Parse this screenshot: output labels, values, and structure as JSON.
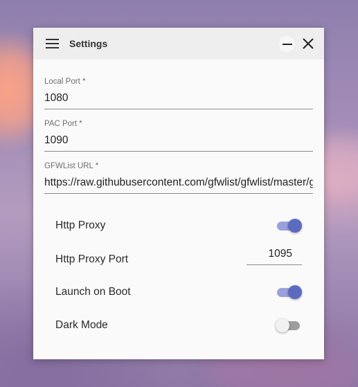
{
  "window": {
    "title": "Settings"
  },
  "icons": {
    "menu": "menu-icon",
    "minimize": "minimize-icon",
    "close": "close-icon"
  },
  "fields": {
    "local_port": {
      "label": "Local Port *",
      "value": "1080"
    },
    "pac_port": {
      "label": "PAC Port *",
      "value": "1090"
    },
    "gfwlist_url": {
      "label": "GFWList URL *",
      "value": "https://raw.githubusercontent.com/gfwlist/gfwlist/master/gfwlist.txt"
    }
  },
  "options": {
    "http_proxy": {
      "label": "Http Proxy",
      "enabled": true
    },
    "http_proxy_port": {
      "label": "Http Proxy Port",
      "value": "1095"
    },
    "launch_on_boot": {
      "label": "Launch on Boot",
      "enabled": true
    },
    "dark_mode": {
      "label": "Dark Mode",
      "enabled": false
    }
  },
  "colors": {
    "accent": "#5c6bc0",
    "accent_track": "#9aa0dd",
    "titlebar": "#eeeeee",
    "panel": "#fafafa"
  }
}
